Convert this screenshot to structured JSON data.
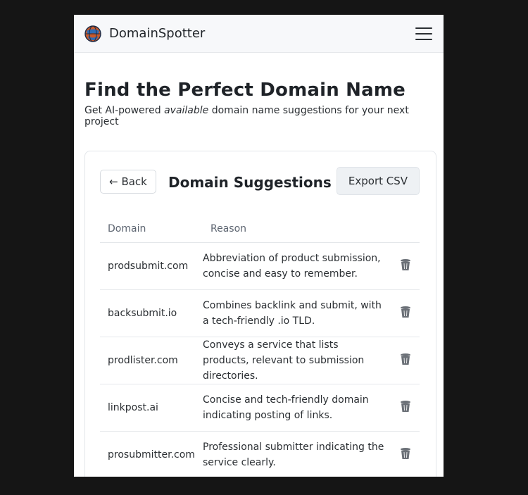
{
  "navbar": {
    "brand_name": "DomainSpotter",
    "logo_icon": "globe-icon",
    "menu_icon": "hamburger-menu-icon"
  },
  "hero": {
    "title": "Find the Perfect Domain Name",
    "subtitle_before": "Get AI-powered ",
    "subtitle_emphasis": "available",
    "subtitle_after": " domain name suggestions for your next project"
  },
  "card": {
    "back_label": "← Back",
    "title": "Domain Suggestions",
    "export_label": "Export CSV",
    "columns": {
      "domain": "Domain",
      "reason": "Reason"
    },
    "rows": [
      {
        "domain": "prodsubmit.com",
        "reason": "Abbreviation of product submission, concise and easy to remember."
      },
      {
        "domain": "backsubmit.io",
        "reason": "Combines backlink and submit, with a tech-friendly .io TLD."
      },
      {
        "domain": "prodlister.com",
        "reason": "Conveys a service that lists products, relevant to submission directories."
      },
      {
        "domain": "linkpost.ai",
        "reason": "Concise and tech-friendly domain indicating posting of links."
      },
      {
        "domain": "prosubmitter.com",
        "reason": "Professional submitter indicating the service clearly."
      }
    ],
    "delete_icon": "trash-icon"
  },
  "colors": {
    "page_background": "#151515",
    "navbar_background": "#f7f8fa",
    "export_button_background": "#eef1f4",
    "icon_gray": "#6b7077"
  }
}
